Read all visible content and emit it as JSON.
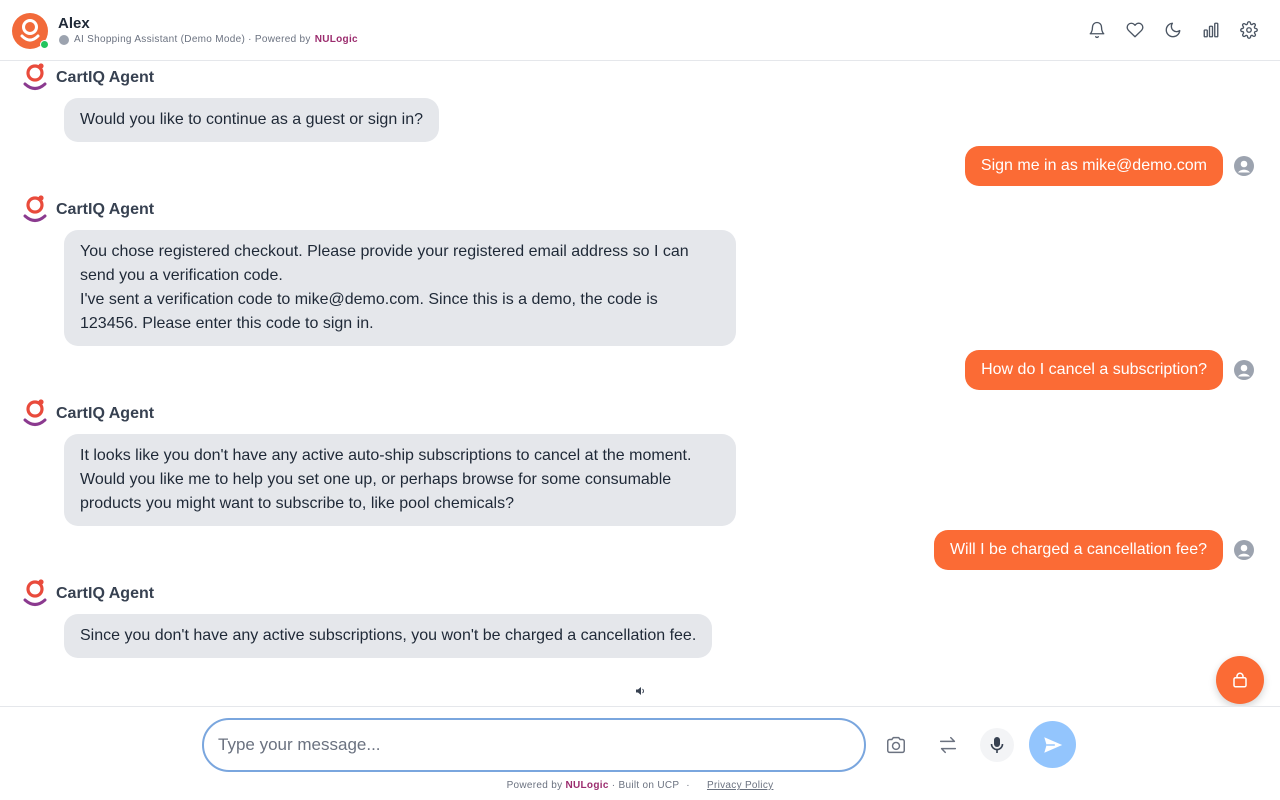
{
  "header": {
    "user_name": "Alex",
    "subtitle_prefix": "AI Shopping Assistant (Demo Mode) · Powered by",
    "brand": "NULogic",
    "icons": [
      "bell-icon",
      "heart-icon",
      "moon-icon",
      "bar-chart-icon",
      "gear-icon"
    ]
  },
  "agent_name": "CartIQ Agent",
  "messages": {
    "agent1": "Would you like to continue as a guest or sign in?",
    "user1": "Sign me in as mike@demo.com",
    "agent2_line1": "You chose registered checkout. Please provide your registered email address so I can send you a verification code.",
    "agent2_line2": "I've sent a verification code to mike@demo.com. Since this is a demo, the code is 123456. Please enter this code to sign in.",
    "user2": "How do I cancel a subscription?",
    "agent3": "It looks like you don't have any active auto-ship subscriptions to cancel at the moment. Would you like me to help you set one up, or perhaps browse for some consumable products you might want to subscribe to, like pool chemicals?",
    "user3": "Will I be charged a cancellation fee?",
    "agent4": "Since you don't have any active subscriptions, you won't be charged a cancellation fee."
  },
  "composer": {
    "placeholder": "Type your message...",
    "value": ""
  },
  "footer": {
    "powered_prefix": "Powered by",
    "brand": "NULogic",
    "built_on": "· Built on UCP",
    "separator": "·",
    "privacy": "Privacy Policy"
  },
  "colors": {
    "accent": "#fb6b35",
    "brand": "#9b2c6e",
    "agent_bubble": "#e5e7eb",
    "send_button": "#93c5fd"
  }
}
